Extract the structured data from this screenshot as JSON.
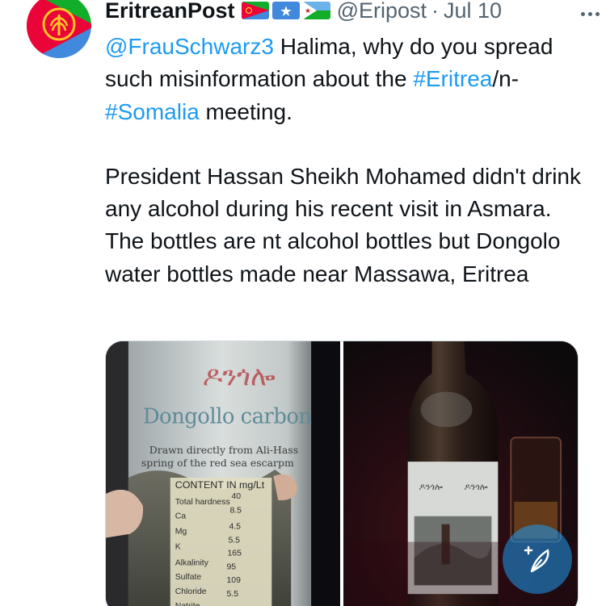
{
  "tweet": {
    "author": {
      "display_name": "EritreanPost",
      "handle": "@Eripost",
      "flags": [
        "eritrea-flag-icon",
        "somalia-flag-icon",
        "djibouti-flag-icon"
      ]
    },
    "separator": "·",
    "date": "Jul 10",
    "text": {
      "mention": "@FrauSchwarz3",
      "p1_after_mention": " Halima, why do you spread such misinformation about the ",
      "hashtag_eritrea": "#Eritrea",
      "joiner": "/n-",
      "hashtag_somalia": "#Somalia",
      "p1_end": " meeting.",
      "p2": "President Hassan Sheikh Mohamed didn't drink any alcohol during his recent visit in Asmara. The bottles are nt alcohol bottles but Dongolo water bottles made near Massawa, Eritrea"
    },
    "media": {
      "left_photo": {
        "label_amharic": "ዶንጎሎ",
        "brand": "Dongollo carbon",
        "tagline_1": "Drawn directly from Ali-Hass",
        "tagline_2": "spring of the red sea escarpm",
        "table_header": "CONTENT IN mg/Lt",
        "rows": [
          {
            "name": "Total hardness",
            "value": "40"
          },
          {
            "name": "Ca",
            "value": "8.5"
          },
          {
            "name": "Mg",
            "value": "4.5"
          },
          {
            "name": "K",
            "value": "5.5"
          },
          {
            "name": "Alkalinity",
            "value": "165"
          },
          {
            "name": "Sulfate",
            "value": "95"
          },
          {
            "name": "Chloride",
            "value": "109"
          },
          {
            "name": "Natrite",
            "value": "5.5"
          }
        ]
      },
      "right_photo": {
        "label_text": "ዶንጎሎ"
      }
    }
  },
  "compose_button": {
    "icon": "feather-plus-icon",
    "color": "#1d9bf0"
  },
  "colors": {
    "link": "#1d9bf0",
    "text": "#0f1419",
    "muted": "#536471"
  }
}
